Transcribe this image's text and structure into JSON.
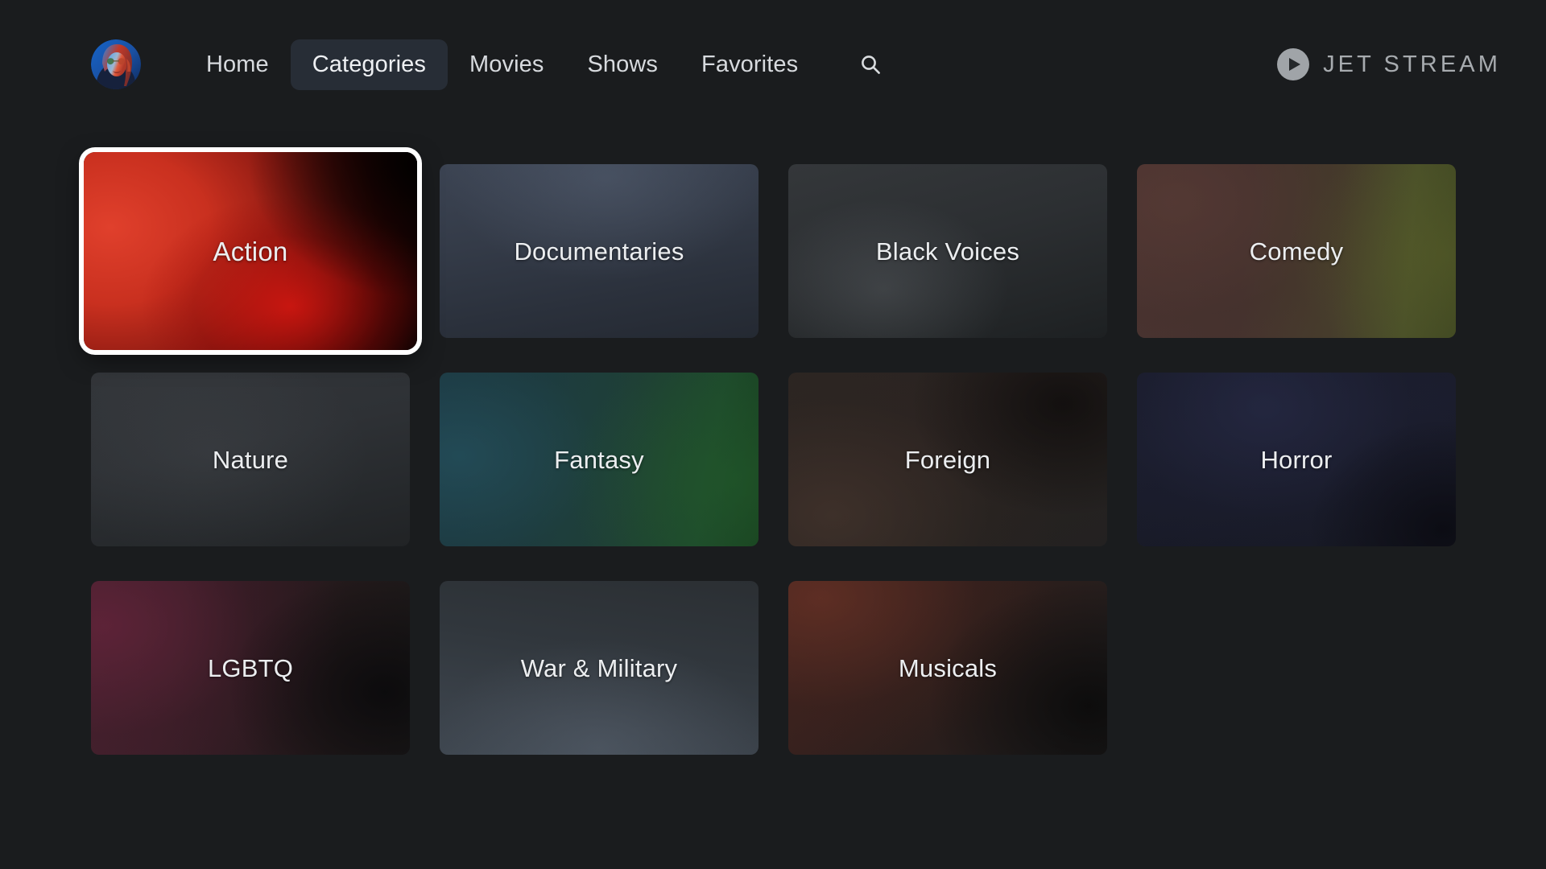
{
  "app": {
    "background_color": "#1a1c1e",
    "brand_name": "JET STREAM",
    "brand_icon": "play-circle-icon",
    "brand_color": "#a7abaf"
  },
  "header": {
    "avatar": {
      "icon": "user-avatar-portrait",
      "description": "circular profile portrait with blue and red lighting"
    },
    "nav_items": [
      {
        "label": "Home",
        "active": false
      },
      {
        "label": "Categories",
        "active": true
      },
      {
        "label": "Movies",
        "active": false
      },
      {
        "label": "Shows",
        "active": false
      },
      {
        "label": "Favorites",
        "active": false
      }
    ],
    "search": {
      "icon": "search-icon",
      "label": "Search"
    },
    "active_pill_color": "#272d36"
  },
  "grid": {
    "focused_index": 0,
    "focus_ring_color": "#ffffff",
    "cards": [
      {
        "label": "Action",
        "art": "art-action",
        "focused": true
      },
      {
        "label": "Documentaries",
        "art": "art-documentaries",
        "focused": false
      },
      {
        "label": "Black Voices",
        "art": "art-blackvoices",
        "focused": false
      },
      {
        "label": "Comedy",
        "art": "art-comedy",
        "focused": false
      },
      {
        "label": "Nature",
        "art": "art-nature",
        "focused": false
      },
      {
        "label": "Fantasy",
        "art": "art-fantasy",
        "focused": false
      },
      {
        "label": "Foreign",
        "art": "art-foreign",
        "focused": false
      },
      {
        "label": "Horror",
        "art": "art-horror",
        "focused": false
      },
      {
        "label": "LGBTQ",
        "art": "art-lgbtq",
        "focused": false
      },
      {
        "label": "War & Military",
        "art": "art-war",
        "focused": false
      },
      {
        "label": "Musicals",
        "art": "art-musicals",
        "focused": false
      }
    ]
  }
}
